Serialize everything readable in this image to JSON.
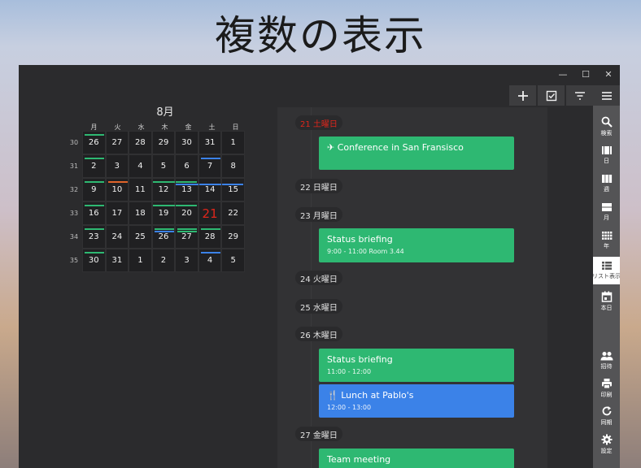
{
  "banner_title": "複数の表示",
  "window": {
    "controls": {
      "minimize": "—",
      "maximize": "☐",
      "close": "✕"
    }
  },
  "toolbar": {
    "buttons": [
      {
        "name": "add-icon",
        "glyph": "+"
      },
      {
        "name": "task-check-icon",
        "glyph": "☑"
      },
      {
        "name": "filter-icon",
        "glyph": "≡"
      }
    ],
    "menu_icon": "hamburger-icon"
  },
  "sidebar": {
    "items": [
      {
        "name": "search",
        "label": "検索",
        "icon": "search-icon"
      },
      {
        "name": "day",
        "label": "日",
        "icon": "day-view-icon"
      },
      {
        "name": "week",
        "label": "週",
        "icon": "week-view-icon"
      },
      {
        "name": "month",
        "label": "月",
        "icon": "month-view-icon"
      },
      {
        "name": "year",
        "label": "年",
        "icon": "year-view-icon"
      },
      {
        "name": "list",
        "label": "リスト表示",
        "icon": "list-view-icon",
        "active": true
      },
      {
        "name": "today",
        "label": "本日",
        "icon": "today-icon"
      },
      {
        "name": "invite",
        "label": "招待",
        "icon": "people-icon"
      },
      {
        "name": "print",
        "label": "印刷",
        "icon": "printer-icon"
      },
      {
        "name": "sync",
        "label": "同期",
        "icon": "sync-icon"
      },
      {
        "name": "settings",
        "label": "設定",
        "icon": "gear-icon"
      }
    ]
  },
  "calendar": {
    "month": "8月",
    "weekdays": [
      "月",
      "火",
      "水",
      "木",
      "金",
      "土",
      "日"
    ],
    "week_numbers": [
      "30",
      "31",
      "32",
      "33",
      "34",
      "35"
    ],
    "weeks": [
      [
        "26",
        "27",
        "28",
        "29",
        "30",
        "31",
        "1"
      ],
      [
        "2",
        "3",
        "4",
        "5",
        "6",
        "7",
        "8"
      ],
      [
        "9",
        "10",
        "11",
        "12",
        "13",
        "14",
        "15"
      ],
      [
        "16",
        "17",
        "18",
        "19",
        "20",
        "21",
        "22"
      ],
      [
        "23",
        "24",
        "25",
        "26",
        "27",
        "28",
        "29"
      ],
      [
        "30",
        "31",
        "1",
        "2",
        "3",
        "4",
        "5"
      ]
    ],
    "today": "21",
    "colors": {
      "green": "#2eb872",
      "blue": "#3b82e8",
      "orange": "#e0642a"
    }
  },
  "agenda": {
    "days": [
      {
        "label": "21 土曜日",
        "highlight": true
      },
      {
        "label": "22 日曜日"
      },
      {
        "label": "23 月曜日"
      },
      {
        "label": "24 火曜日"
      },
      {
        "label": "25 水曜日"
      },
      {
        "label": "26 木曜日"
      },
      {
        "label": "27 金曜日"
      }
    ],
    "events": [
      {
        "title": "✈ Conference in San Fransisco",
        "sub": "",
        "color": "green"
      },
      {
        "title": "Status briefing",
        "sub": "9:00 - 11:00 Room 3.44",
        "color": "green"
      },
      {
        "title": "Status briefing",
        "sub": "11:00 - 12:00",
        "color": "green"
      },
      {
        "title": "🍴 Lunch at Pablo's",
        "sub": "12:00 - 13:00",
        "color": "blue"
      },
      {
        "title": "Team meeting",
        "sub": "",
        "color": "green"
      }
    ]
  }
}
